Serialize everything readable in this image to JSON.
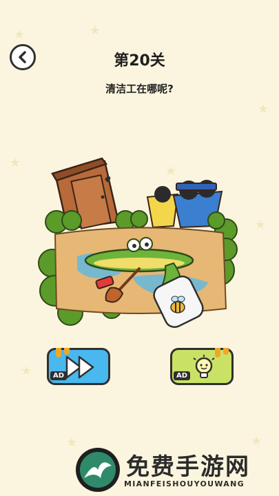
{
  "header": {
    "back_icon": "chevron-left-icon",
    "level_title": "第20关",
    "question": "清洁工在哪呢?"
  },
  "scene": {
    "description_icons": [
      "outhouse-icon",
      "trash-bins-icon",
      "crocodile-icon",
      "broom-icon",
      "bee-icon"
    ]
  },
  "buttons": {
    "skip": {
      "ad_label": "AD",
      "icon": "fast-forward-icon"
    },
    "hint": {
      "ad_label": "AD",
      "icon": "lightbulb-icon"
    }
  },
  "brand": {
    "name": "免费手游网",
    "url": "MIANFEISHOUYOUWANG"
  },
  "colors": {
    "background": "#fbf5df",
    "skip_button": "#48b8ee",
    "hint_button": "#c9e266"
  }
}
